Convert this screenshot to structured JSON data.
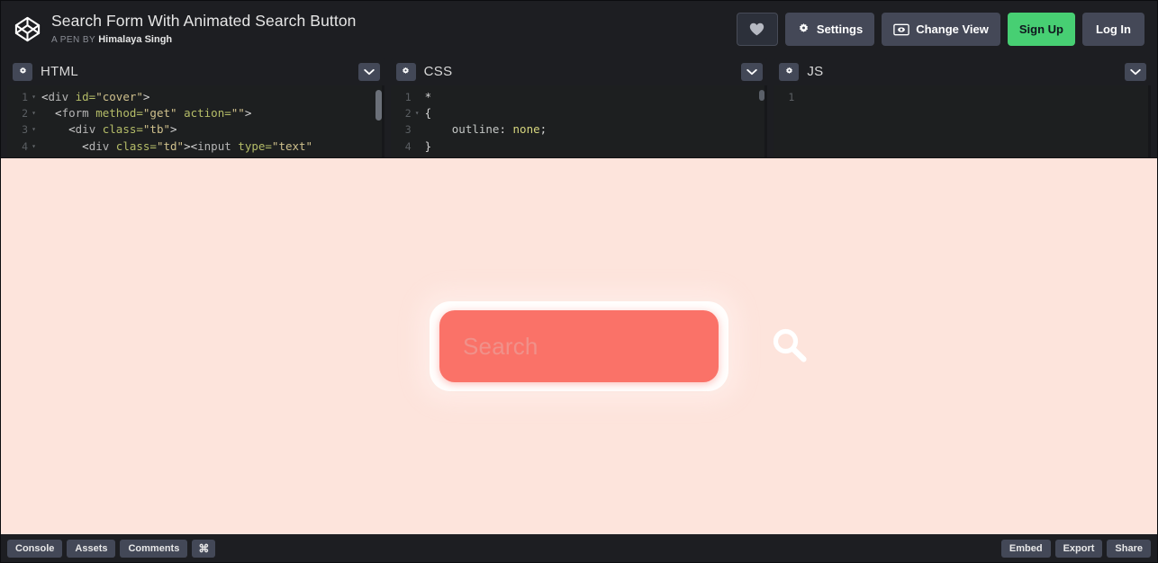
{
  "header": {
    "logo_icon": "codepen-logo-icon",
    "pen_title": "Search Form With Animated Search Button",
    "byline_prefix": "A PEN BY",
    "author": "Himalaya Singh",
    "actions": {
      "heart_icon": "heart-icon",
      "settings_label": "Settings",
      "settings_icon": "gear-icon",
      "change_view_label": "Change View",
      "change_view_icon": "screen-eye-icon",
      "signup_label": "Sign Up",
      "login_label": "Log In"
    },
    "colors": {
      "bar_bg": "#1d1e22",
      "button_bg": "#444857",
      "signup_green": "#47cf73",
      "signup_text": "#10161e"
    }
  },
  "editors": [
    {
      "name": "HTML",
      "gear_icon": "gear-icon",
      "chevron_icon": "chevron-down-icon",
      "lines": [
        {
          "num": "1",
          "fold": "▾",
          "tokens": [
            {
              "t": "<",
              "c": "t-punct"
            },
            {
              "t": "div",
              "c": "t-tag"
            },
            {
              "t": " id=",
              "c": "t-attr"
            },
            {
              "t": "\"cover\"",
              "c": "t-str"
            },
            {
              "t": ">",
              "c": "t-punct"
            }
          ]
        },
        {
          "num": "2",
          "fold": "▾",
          "tokens": [
            {
              "t": "  <",
              "c": "t-punct"
            },
            {
              "t": "form",
              "c": "t-tag"
            },
            {
              "t": " method=",
              "c": "t-attr"
            },
            {
              "t": "\"get\"",
              "c": "t-str"
            },
            {
              "t": " action=",
              "c": "t-attr"
            },
            {
              "t": "\"\"",
              "c": "t-str"
            },
            {
              "t": ">",
              "c": "t-punct"
            }
          ]
        },
        {
          "num": "3",
          "fold": "▾",
          "tokens": [
            {
              "t": "    <",
              "c": "t-punct"
            },
            {
              "t": "div",
              "c": "t-tag"
            },
            {
              "t": " class=",
              "c": "t-attr"
            },
            {
              "t": "\"tb\"",
              "c": "t-str"
            },
            {
              "t": ">",
              "c": "t-punct"
            }
          ]
        },
        {
          "num": "4",
          "fold": "▾",
          "tokens": [
            {
              "t": "      <",
              "c": "t-punct"
            },
            {
              "t": "div",
              "c": "t-tag"
            },
            {
              "t": " class=",
              "c": "t-attr"
            },
            {
              "t": "\"td\"",
              "c": "t-str"
            },
            {
              "t": "><",
              "c": "t-punct"
            },
            {
              "t": "input",
              "c": "t-tag"
            },
            {
              "t": " type=",
              "c": "t-attr"
            },
            {
              "t": "\"text\"",
              "c": "t-str"
            }
          ]
        }
      ]
    },
    {
      "name": "CSS",
      "gear_icon": "gear-icon",
      "chevron_icon": "chevron-down-icon",
      "lines": [
        {
          "num": "1",
          "fold": "",
          "tokens": [
            {
              "t": "*",
              "c": "t-sel"
            }
          ]
        },
        {
          "num": "2",
          "fold": "▾",
          "tokens": [
            {
              "t": "{",
              "c": "t-punct"
            }
          ]
        },
        {
          "num": "3",
          "fold": "",
          "tokens": [
            {
              "t": "    outline",
              "c": "t-prop"
            },
            {
              "t": ": ",
              "c": "t-punct"
            },
            {
              "t": "none",
              "c": "t-val"
            },
            {
              "t": ";",
              "c": "t-punct"
            }
          ]
        },
        {
          "num": "4",
          "fold": "",
          "tokens": [
            {
              "t": "}",
              "c": "t-punct"
            }
          ]
        }
      ]
    },
    {
      "name": "JS",
      "gear_icon": "gear-icon",
      "chevron_icon": "chevron-down-icon",
      "lines": [
        {
          "num": "1",
          "fold": "",
          "tokens": [
            {
              "t": "",
              "c": "t-punct"
            }
          ]
        }
      ]
    }
  ],
  "preview": {
    "background_color": "#fde4dc",
    "search": {
      "placeholder": "Search",
      "value": "",
      "icon": "magnifier-icon",
      "box_color": "#fa7268",
      "frame_color": "#ffffff",
      "placeholder_color": "#f0918a"
    }
  },
  "bottombar": {
    "left": [
      {
        "label": "Console",
        "name": "console-button"
      },
      {
        "label": "Assets",
        "name": "assets-button"
      },
      {
        "label": "Comments",
        "name": "comments-button"
      },
      {
        "label": "⌘",
        "name": "shortcuts-button"
      }
    ],
    "right": [
      {
        "label": "Embed",
        "name": "embed-button"
      },
      {
        "label": "Export",
        "name": "export-button"
      },
      {
        "label": "Share",
        "name": "share-button"
      }
    ]
  }
}
